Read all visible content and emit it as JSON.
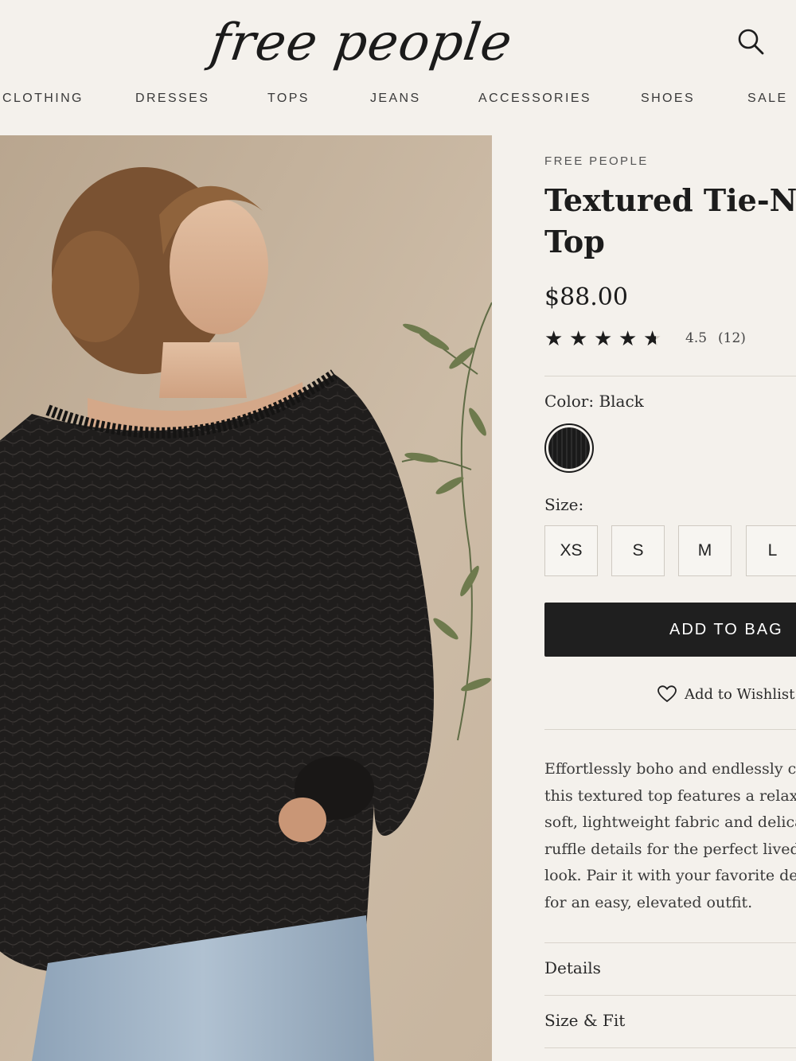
{
  "header": {
    "logo_text": "free people",
    "search_icon": "search-icon",
    "nav": [
      "CLOTHING",
      "DRESSES",
      "TOPS",
      "JEANS",
      "ACCESSORIES",
      "SHOES",
      "SALE"
    ]
  },
  "product": {
    "brand": "FREE PEOPLE",
    "title_line1": "Textured Tie-Neck",
    "title_line2": "Top",
    "price": "$88.00",
    "rating": {
      "value": 4.5,
      "value_label": "4.5",
      "max": 5,
      "count_label": "(12)"
    },
    "color": {
      "label": "Color: Black",
      "swatch_name": "Black",
      "swatch_hex": "#1a1a1a"
    },
    "size": {
      "label": "Size:",
      "options": [
        "XS",
        "S",
        "M",
        "L"
      ]
    },
    "add_to_bag_label": "ADD TO BAG",
    "wishlist_label": "Add to Wishlist",
    "wishlist_icon": "heart-icon",
    "description_lines": [
      "Effortlessly boho and endlessly chic,",
      "this textured top features a relaxed fit,",
      "soft, lightweight fabric and delicate",
      "ruffle details for the perfect lived-in",
      "look. Pair it with your favorite denim",
      "for an easy, elevated outfit."
    ],
    "accordions": [
      "Details",
      "Size & Fit"
    ]
  },
  "colors": {
    "background": "#f4f1ec",
    "text": "#1d1d1d",
    "button_bg": "#1f1f1f",
    "divider": "#d9d4cc"
  }
}
